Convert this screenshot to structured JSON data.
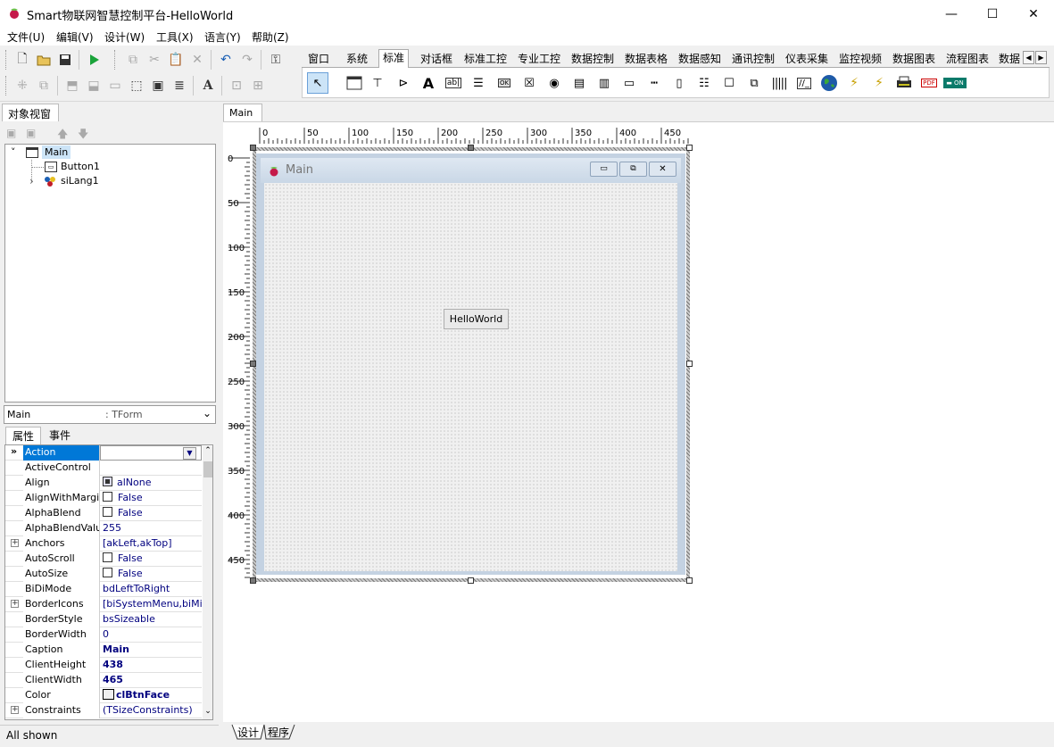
{
  "window": {
    "title": "Smart物联网智慧控制平台-HelloWorld",
    "minimize": "—",
    "maximize": "☐",
    "close": "✕"
  },
  "menu": [
    "文件(U)",
    "编辑(V)",
    "设计(W)",
    "工具(X)",
    "语言(Y)",
    "帮助(Z)"
  ],
  "palette_tabs": [
    "窗口",
    "系统",
    "标准",
    "对话框",
    "标准工控",
    "专业工控",
    "数据控制",
    "数据表格",
    "数据感知",
    "通讯控制",
    "仪表采集",
    "监控视频",
    "数据图表",
    "流程图表",
    "数据"
  ],
  "palette_active": "标准",
  "object_panel": {
    "tab": "对象视窗",
    "tree": [
      {
        "label": "Main",
        "expanded": "˅"
      },
      {
        "label": "Button1"
      },
      {
        "label": "siLang1",
        "expander": "›"
      }
    ]
  },
  "combo": {
    "name": "Main",
    "type": ": TForm"
  },
  "prop_tabs": [
    "属性",
    "事件"
  ],
  "properties": [
    {
      "name": "Action",
      "value": "",
      "kind": "dropdown",
      "selected": true
    },
    {
      "name": "ActiveControl",
      "value": ""
    },
    {
      "name": "Align",
      "value": "alNone",
      "kind": "align"
    },
    {
      "name": "AlignWithMargins",
      "value": "False",
      "kind": "check"
    },
    {
      "name": "AlphaBlend",
      "value": "False",
      "kind": "check"
    },
    {
      "name": "AlphaBlendValue",
      "value": "255"
    },
    {
      "name": "Anchors",
      "value": "[akLeft,akTop]",
      "expand": "+"
    },
    {
      "name": "AutoScroll",
      "value": "False",
      "kind": "check"
    },
    {
      "name": "AutoSize",
      "value": "False",
      "kind": "check"
    },
    {
      "name": "BiDiMode",
      "value": "bdLeftToRight"
    },
    {
      "name": "BorderIcons",
      "value": "[biSystemMenu,biMinimize,biMaximize]",
      "expand": "+"
    },
    {
      "name": "BorderStyle",
      "value": "bsSizeable"
    },
    {
      "name": "BorderWidth",
      "value": "0"
    },
    {
      "name": "Caption",
      "value": "Main",
      "bold": true
    },
    {
      "name": "ClientHeight",
      "value": "438",
      "bold": true
    },
    {
      "name": "ClientWidth",
      "value": "465",
      "bold": true
    },
    {
      "name": "Color",
      "value": "clBtnFace",
      "bold": true,
      "kind": "color"
    },
    {
      "name": "Constraints",
      "value": "(TSizeConstraints)",
      "expand": "+"
    }
  ],
  "status": "All shown",
  "design_tab": "Main",
  "ruler_h": [
    "0",
    "50",
    "100",
    "150",
    "200",
    "250",
    "300",
    "350",
    "400",
    "450"
  ],
  "ruler_v": [
    "0",
    "50",
    "100",
    "150",
    "200",
    "250",
    "300",
    "350",
    "400",
    "450"
  ],
  "form": {
    "caption": "Main",
    "button_caption": "HelloWorld"
  },
  "bottom_tabs": [
    "设计",
    "程序"
  ],
  "colors": {
    "selection": "#0078d7",
    "value_text": "#00007f"
  }
}
